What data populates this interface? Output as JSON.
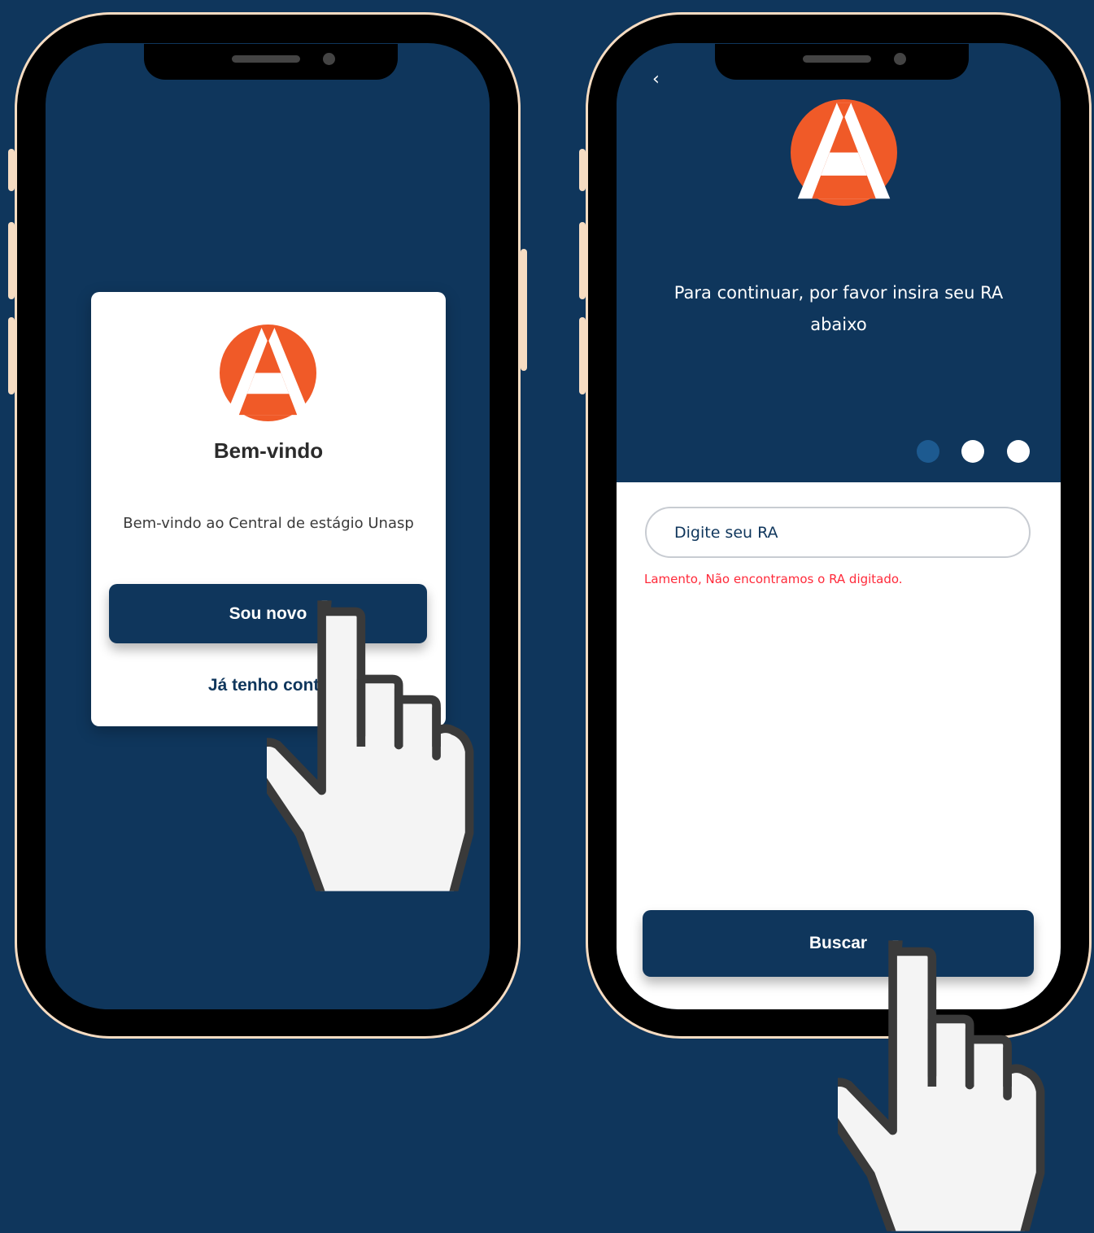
{
  "welcome_screen": {
    "title": "Bem-vindo",
    "subtitle": "Bem-vindo ao Central de estágio Unasp",
    "primary_button": "Sou novo",
    "secondary_link": "Já tenho conta"
  },
  "ra_screen": {
    "instructions": "Para continuar, por favor insira seu RA abaixo",
    "input_placeholder": "Digite seu RA",
    "error_message": "Lamento, Não encontramos o RA digitado.",
    "search_button": "Buscar",
    "step_indicator": {
      "total": 3,
      "active": 1
    }
  },
  "colors": {
    "background": "#0f365c",
    "brand_orange": "#f05a28",
    "frame_accent": "#f6dcc2",
    "error": "#ff2a3a",
    "active_dot": "#1d5a90"
  },
  "icons": {
    "logo": "logo-a-icon",
    "back": "back-chevron-icon",
    "pointer": "pointing-hand-icon"
  }
}
